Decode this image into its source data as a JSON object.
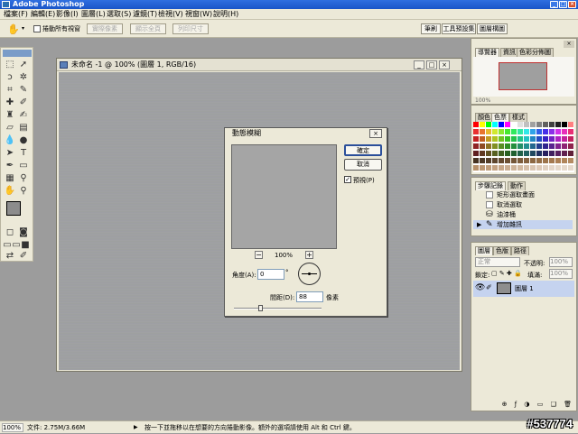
{
  "window": {
    "title": "Adobe Photoshop"
  },
  "menubar": {
    "items": [
      "檔案(F)",
      "編輯(E)",
      "影像(I)",
      "圖層(L)",
      "選取(S)",
      "濾鏡(T)",
      "檢視(V)",
      "視窗(W)",
      "說明(H)"
    ]
  },
  "options": {
    "scroll_all_label": "捲動所有視窗",
    "actual_pixels": "實際像素",
    "fit_on_screen": "顯示全頁",
    "print_size": "列印尺寸",
    "workspace_tabs": [
      "筆刷",
      "工具預設集",
      "圖層構圖"
    ]
  },
  "document": {
    "title": "未命名 -1 @ 100% (圖層 1, RGB/16)"
  },
  "dialog": {
    "title": "動態模糊",
    "ok": "確定",
    "cancel": "取消",
    "preview_label": "預視(P)",
    "zoom": "100%",
    "zoom_out": "−",
    "zoom_in": "+",
    "angle_label": "角度(A):",
    "angle_value": "0",
    "degree": "°",
    "distance_label": "間距(D):",
    "distance_value": "88",
    "distance_unit": "像素",
    "distance_fraction": 0.3
  },
  "navigator": {
    "tabs": [
      "導覽器",
      "資訊",
      "色彩分佈圖"
    ],
    "zoom": "100%"
  },
  "color": {
    "tabs": [
      "顏色",
      "色票",
      "樣式"
    ]
  },
  "history": {
    "tabs": [
      "步驟記錄",
      "動作"
    ],
    "items": [
      "矩形選取畫面",
      "取消選取",
      "油漆桶",
      "增加雜訊"
    ]
  },
  "layers": {
    "tabs": [
      "圖層",
      "色版",
      "路徑"
    ],
    "blend_mode": "正常",
    "opacity_label": "不透明:",
    "opacity_value": "100%",
    "lock_label": "鎖定:",
    "fill_label": "填滿:",
    "fill_value": "100%",
    "layer_name": "圖層 1"
  },
  "status": {
    "zoom": "100%",
    "doc_size": "文件: 2.75M/3.66M",
    "hint": "按一下並拖移以在想要的方向捲動影像。額外的選項請使用 Alt 和 Ctrl 鍵。"
  },
  "watermark": "#537774",
  "colors": {
    "titlebar": "#1f5fd6",
    "panel_bg": "#ece9d8",
    "selection": "#c5d3ef"
  }
}
